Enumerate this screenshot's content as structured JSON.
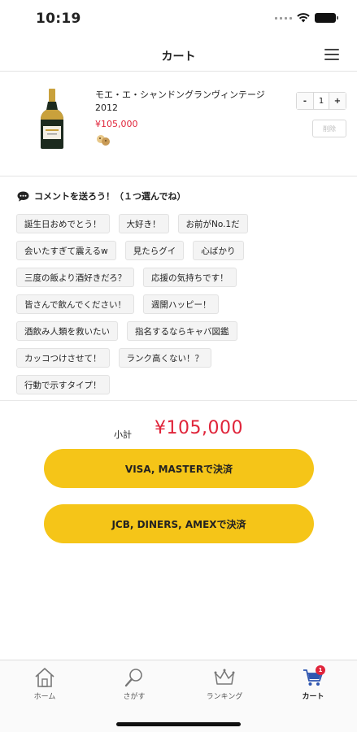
{
  "status": {
    "time": "10:19"
  },
  "header": {
    "title": "カート"
  },
  "cart": {
    "item": {
      "name": "モエ・エ・シャンドングランヴィンテージ2012",
      "price": "¥105,000",
      "quantity": "1",
      "minus_label": "-",
      "plus_label": "+",
      "delete_label": "削除"
    }
  },
  "comments": {
    "heading": "コメントを送ろう！（１つ選んでね）",
    "rows": [
      [
        "誕生日おめでとう！",
        "大好き！",
        "お前がNo.1だ"
      ],
      [
        "会いたすぎて震えるw",
        "見たらグイ",
        "心ばかり"
      ],
      [
        "三度の飯より酒好きだろ？",
        "応援の気持ちです！"
      ],
      [
        "皆さんで飲んでください！",
        "週開ハッピー！"
      ],
      [
        "酒飲み人類を救いたい",
        "指名するならキャバ図鑑"
      ],
      [
        "カッコつけさせて！",
        "ランク高くない！？"
      ],
      [
        "行動で示すタイプ！"
      ]
    ]
  },
  "subtotal": {
    "label": "小計",
    "value": "¥105,000"
  },
  "payment": {
    "button1": "VISA, MASTERで決済",
    "button2": "JCB, DINERS, AMEXで決済"
  },
  "tabs": {
    "home": "ホーム",
    "search": "さがす",
    "ranking": "ランキング",
    "cart": "カート",
    "cart_badge": "1",
    "active": "cart"
  },
  "colors": {
    "accent": "#f5c518",
    "price": "#e0243a"
  }
}
